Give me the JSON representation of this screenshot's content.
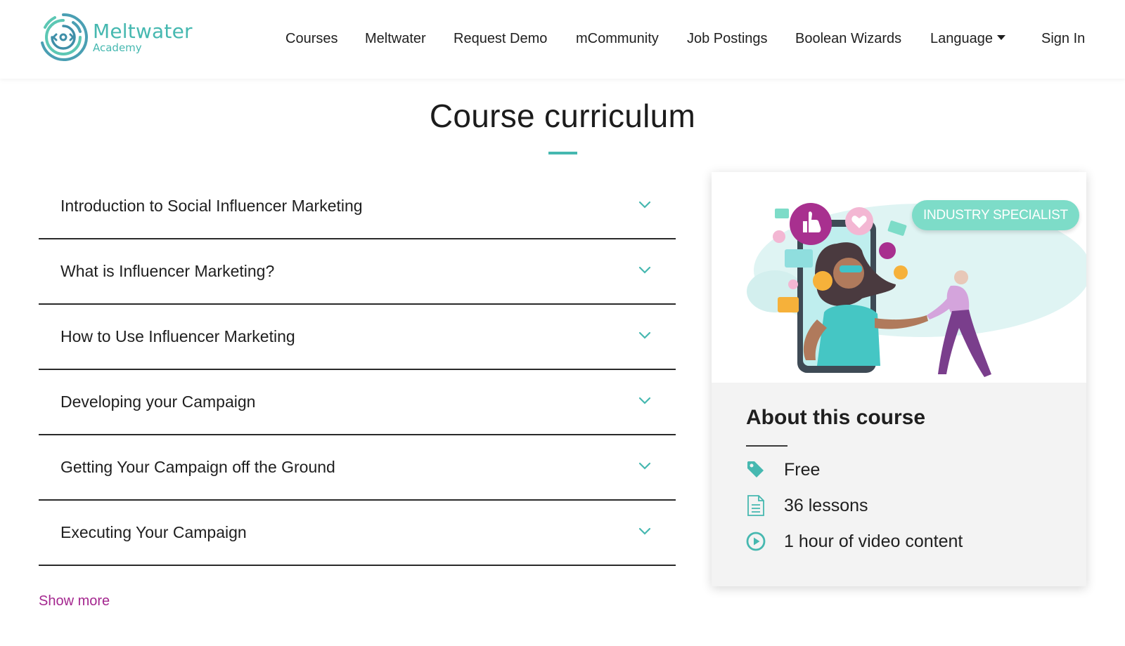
{
  "brand": {
    "name": "Meltwater",
    "subtitle": "Academy",
    "accent_color": "#46b8b0",
    "link_color": "#a4278f"
  },
  "nav": {
    "items": [
      "Courses",
      "Meltwater",
      "Request Demo",
      "mCommunity",
      "Job Postings",
      "Boolean Wizards"
    ],
    "language_label": "Language",
    "sign_in_label": "Sign In"
  },
  "curriculum": {
    "title": "Course curriculum",
    "modules": [
      "Introduction to Social Influencer Marketing",
      "What is Influencer Marketing?",
      "How to Use Influencer Marketing",
      "Developing your Campaign",
      "Getting Your Campaign off the Ground",
      "Executing Your Campaign"
    ],
    "show_more_label": "Show more"
  },
  "card": {
    "badge": "INDUSTRY SPECIALIST",
    "about_title": "About this course",
    "facts": [
      {
        "icon": "price-tag-icon",
        "text": "Free"
      },
      {
        "icon": "document-icon",
        "text": "36 lessons"
      },
      {
        "icon": "play-circle-icon",
        "text": "1 hour of video content"
      }
    ]
  }
}
